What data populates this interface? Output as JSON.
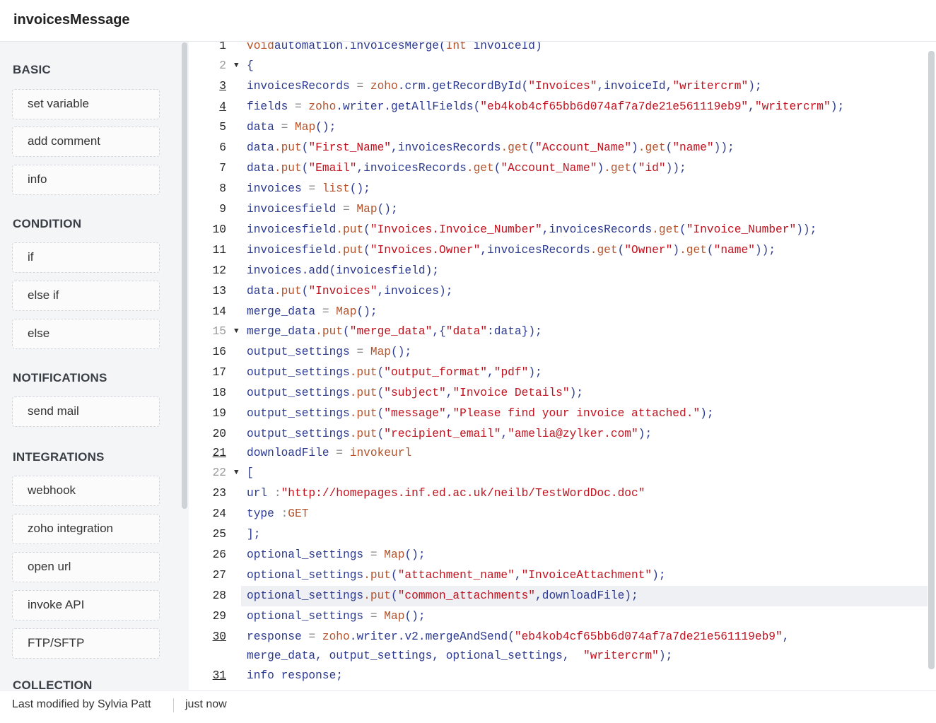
{
  "header": {
    "title": "invoicesMessage"
  },
  "sidebar": {
    "sections": [
      {
        "label": "BASIC",
        "items": [
          "set variable",
          "add comment",
          "info"
        ]
      },
      {
        "label": "CONDITION",
        "items": [
          "if",
          "else if",
          "else"
        ]
      },
      {
        "label": "NOTIFICATIONS",
        "items": [
          "send mail"
        ]
      },
      {
        "label": "INTEGRATIONS",
        "items": [
          "webhook",
          "zoho integration",
          "open url",
          "invoke API",
          "FTP/SFTP"
        ]
      },
      {
        "label": "COLLECTION",
        "items": []
      }
    ]
  },
  "code": {
    "lines": [
      {
        "n": "1",
        "t": [
          [
            "kw",
            "void"
          ],
          [
            "",
            "automation.invoicesMerge("
          ],
          [
            "kw",
            "Int"
          ],
          [
            "",
            " invoiceId)"
          ]
        ]
      },
      {
        "n": "2",
        "fold": true,
        "dim": true,
        "t": [
          [
            "",
            "{"
          ]
        ]
      },
      {
        "n": "3",
        "u": true,
        "t": [
          [
            "",
            "invoicesRecords "
          ],
          [
            "op",
            "="
          ],
          [
            "kw",
            " zoho"
          ],
          [
            "",
            ".crm.getRecordById("
          ],
          [
            "str",
            "\"Invoices\""
          ],
          [
            "",
            ",invoiceId,"
          ],
          [
            "str",
            "\"writercrm\""
          ],
          [
            "",
            ");"
          ]
        ]
      },
      {
        "n": "4",
        "u": true,
        "t": [
          [
            "",
            "fields "
          ],
          [
            "op",
            "="
          ],
          [
            "kw",
            " zoho"
          ],
          [
            "",
            ".writer.getAllFields("
          ],
          [
            "str",
            "\"eb4kob4cf65bb6d074af7a7de21e561119eb9\""
          ],
          [
            "",
            ","
          ],
          [
            "str",
            "\"writercrm\""
          ],
          [
            "",
            ");"
          ]
        ]
      },
      {
        "n": "5",
        "t": [
          [
            "",
            "data "
          ],
          [
            "op",
            "="
          ],
          [
            "kw",
            " Map"
          ],
          [
            "",
            "();"
          ]
        ]
      },
      {
        "n": "6",
        "t": [
          [
            "",
            "data"
          ],
          [
            "kw",
            ".put"
          ],
          [
            "",
            "("
          ],
          [
            "str",
            "\"First_Name\""
          ],
          [
            "",
            ",invoicesRecords"
          ],
          [
            "kw",
            ".get"
          ],
          [
            "",
            "("
          ],
          [
            "str",
            "\"Account_Name\""
          ],
          [
            "",
            ")"
          ],
          [
            "kw",
            ".get"
          ],
          [
            "",
            "("
          ],
          [
            "str",
            "\"name\""
          ],
          [
            "",
            "));"
          ]
        ]
      },
      {
        "n": "7",
        "t": [
          [
            "",
            "data"
          ],
          [
            "kw",
            ".put"
          ],
          [
            "",
            "("
          ],
          [
            "str",
            "\"Email\""
          ],
          [
            "",
            ",invoicesRecords"
          ],
          [
            "kw",
            ".get"
          ],
          [
            "",
            "("
          ],
          [
            "str",
            "\"Account_Name\""
          ],
          [
            "",
            ")"
          ],
          [
            "kw",
            ".get"
          ],
          [
            "",
            "("
          ],
          [
            "str",
            "\"id\""
          ],
          [
            "",
            "));"
          ]
        ]
      },
      {
        "n": "8",
        "t": [
          [
            "",
            "invoices "
          ],
          [
            "op",
            "="
          ],
          [
            "kw",
            " list"
          ],
          [
            "",
            "();"
          ]
        ]
      },
      {
        "n": "9",
        "t": [
          [
            "",
            "invoicesfield "
          ],
          [
            "op",
            "="
          ],
          [
            "kw",
            " Map"
          ],
          [
            "",
            "();"
          ]
        ]
      },
      {
        "n": "10",
        "t": [
          [
            "",
            "invoicesfield"
          ],
          [
            "kw",
            ".put"
          ],
          [
            "",
            "("
          ],
          [
            "str",
            "\"Invoices.Invoice_Number\""
          ],
          [
            "",
            ",invoicesRecords"
          ],
          [
            "kw",
            ".get"
          ],
          [
            "",
            "("
          ],
          [
            "str",
            "\"Invoice_Number\""
          ],
          [
            "",
            "));"
          ]
        ]
      },
      {
        "n": "11",
        "t": [
          [
            "",
            "invoicesfield"
          ],
          [
            "kw",
            ".put"
          ],
          [
            "",
            "("
          ],
          [
            "str",
            "\"Invoices.Owner\""
          ],
          [
            "",
            ",invoicesRecords"
          ],
          [
            "kw",
            ".get"
          ],
          [
            "",
            "("
          ],
          [
            "str",
            "\"Owner\""
          ],
          [
            "",
            ")"
          ],
          [
            "kw",
            ".get"
          ],
          [
            "",
            "("
          ],
          [
            "str",
            "\"name\""
          ],
          [
            "",
            "));"
          ]
        ]
      },
      {
        "n": "12",
        "t": [
          [
            "",
            "invoices.add(invoicesfield);"
          ]
        ]
      },
      {
        "n": "13",
        "t": [
          [
            "",
            "data"
          ],
          [
            "kw",
            ".put"
          ],
          [
            "",
            "("
          ],
          [
            "str",
            "\"Invoices\""
          ],
          [
            "",
            ",invoices);"
          ]
        ]
      },
      {
        "n": "14",
        "t": [
          [
            "",
            "merge_data "
          ],
          [
            "op",
            "="
          ],
          [
            "kw",
            " Map"
          ],
          [
            "",
            "();"
          ]
        ]
      },
      {
        "n": "15",
        "fold": true,
        "dim": true,
        "t": [
          [
            "",
            "merge_data"
          ],
          [
            "kw",
            ".put"
          ],
          [
            "",
            "("
          ],
          [
            "str",
            "\"merge_data\""
          ],
          [
            "",
            ",{"
          ],
          [
            "str",
            "\"data\""
          ],
          [
            "",
            ":data});"
          ]
        ]
      },
      {
        "n": "16",
        "t": [
          [
            "",
            "output_settings "
          ],
          [
            "op",
            "="
          ],
          [
            "kw",
            " Map"
          ],
          [
            "",
            "();"
          ]
        ]
      },
      {
        "n": "17",
        "t": [
          [
            "",
            "output_settings"
          ],
          [
            "kw",
            ".put"
          ],
          [
            "",
            "("
          ],
          [
            "str",
            "\"output_format\""
          ],
          [
            "",
            ","
          ],
          [
            "str",
            "\"pdf\""
          ],
          [
            "",
            ");"
          ]
        ]
      },
      {
        "n": "18",
        "t": [
          [
            "",
            "output_settings"
          ],
          [
            "kw",
            ".put"
          ],
          [
            "",
            "("
          ],
          [
            "str",
            "\"subject\""
          ],
          [
            "",
            ","
          ],
          [
            "str",
            "\"Invoice Details\""
          ],
          [
            "",
            ");"
          ]
        ]
      },
      {
        "n": "19",
        "t": [
          [
            "",
            "output_settings"
          ],
          [
            "kw",
            ".put"
          ],
          [
            "",
            "("
          ],
          [
            "str",
            "\"message\""
          ],
          [
            "",
            ","
          ],
          [
            "str",
            "\"Please find your invoice attached.\""
          ],
          [
            "",
            ");"
          ]
        ]
      },
      {
        "n": "20",
        "t": [
          [
            "",
            "output_settings"
          ],
          [
            "kw",
            ".put"
          ],
          [
            "",
            "("
          ],
          [
            "str",
            "\"recipient_email\""
          ],
          [
            "",
            ","
          ],
          [
            "str",
            "\"amelia@zylker.com\""
          ],
          [
            "",
            ");"
          ]
        ]
      },
      {
        "n": "21",
        "u": true,
        "t": [
          [
            "",
            "downloadFile "
          ],
          [
            "op",
            "="
          ],
          [
            "kw",
            " invokeurl"
          ]
        ]
      },
      {
        "n": "22",
        "fold": true,
        "dim": true,
        "t": [
          [
            "",
            "["
          ]
        ]
      },
      {
        "n": "23",
        "t": [
          [
            "",
            "url "
          ],
          [
            "op",
            ":"
          ],
          [
            "str",
            "\"http://homepages.inf.ed.ac.uk/neilb/TestWordDoc.doc\""
          ]
        ]
      },
      {
        "n": "24",
        "t": [
          [
            "",
            "type "
          ],
          [
            "op",
            ":"
          ],
          [
            "kw",
            "GET"
          ]
        ]
      },
      {
        "n": "25",
        "t": [
          [
            "",
            "];"
          ]
        ]
      },
      {
        "n": "26",
        "t": [
          [
            "",
            "optional_settings "
          ],
          [
            "op",
            "="
          ],
          [
            "kw",
            " Map"
          ],
          [
            "",
            "();"
          ]
        ]
      },
      {
        "n": "27",
        "t": [
          [
            "",
            "optional_settings"
          ],
          [
            "kw",
            ".put"
          ],
          [
            "",
            "("
          ],
          [
            "str",
            "\"attachment_name\""
          ],
          [
            "",
            ","
          ],
          [
            "str",
            "\"InvoiceAttachment\""
          ],
          [
            "",
            ");"
          ]
        ]
      },
      {
        "n": "28",
        "hl": true,
        "t": [
          [
            "",
            "optional_settings"
          ],
          [
            "kw",
            ".put"
          ],
          [
            "",
            "("
          ],
          [
            "str",
            "\"common_attachments\""
          ],
          [
            "",
            ",downloadFile);"
          ]
        ]
      },
      {
        "n": "29",
        "t": [
          [
            "",
            "optional_settings "
          ],
          [
            "op",
            "="
          ],
          [
            "kw",
            " Map"
          ],
          [
            "",
            "();"
          ]
        ]
      },
      {
        "n": "30",
        "u": true,
        "t": [
          [
            "",
            "response "
          ],
          [
            "op",
            "="
          ],
          [
            "kw",
            " zoho"
          ],
          [
            "",
            ".writer.v2.mergeAndSend("
          ],
          [
            "str",
            "\"eb4kob4cf65bb6d074af7a7de21e561119eb9\""
          ],
          [
            "",
            ","
          ]
        ]
      },
      {
        "n": "",
        "t": [
          [
            "",
            "merge_data, output_settings, optional_settings,  "
          ],
          [
            "str",
            "\"writercrm\""
          ],
          [
            "",
            ");"
          ]
        ]
      },
      {
        "n": "31",
        "u": true,
        "t": [
          [
            "",
            "info response;"
          ]
        ]
      }
    ]
  },
  "footer": {
    "modified": "Last modified by Sylvia Patt",
    "time": "just now"
  }
}
